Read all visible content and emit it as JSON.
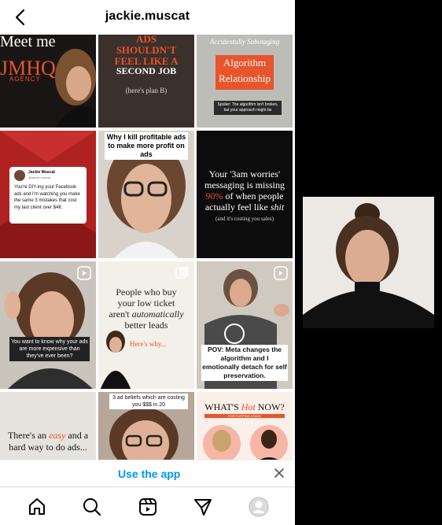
{
  "header": {
    "username": "jackie.muscat"
  },
  "posts": [
    {
      "text": "Meet me",
      "sub": "JMHQ",
      "sub2": "AGENCY"
    },
    {
      "line1": "ADS",
      "line2": "SHOULDN'T",
      "line3": "FEEL LIKE A",
      "line4": "SECOND JOB",
      "line5": "(here's plan B)"
    },
    {
      "top": "Accidentally Sabotaging",
      "hl1": "Algorithm",
      "hl2": "Relationship",
      "foot": "Spoiler: The algorithm isn't broken, but your approach might be"
    },
    {
      "name": "Jackie Muscat",
      "handle": "@jackie.muscat",
      "body": "You're DIY-ing your Facebook ads and I'm watching you make the same 3 mistakes that cost my last client over $4K"
    },
    {
      "caption": "Why I kill profitable ads to make more profit on ads"
    },
    {
      "l1": "Your '3am worries'",
      "l2": "messaging is missing",
      "l3a": "90%",
      "l3b": " of when people",
      "l4": "actually feel like ",
      "l4b": "shit",
      "l5": "(and it's costing you sales)"
    },
    {
      "caption": "You want to know why your ads are more expensive than they've ever been?"
    },
    {
      "l1": "People who buy",
      "l2": "your low ticket",
      "l3": "aren't ",
      "l3b": "automatically",
      "l4": "better leads",
      "l5": "Here's why..."
    },
    {
      "caption": "POV: Meta changes the algorithm and I emotionally detach for self preservation."
    },
    {
      "l1": "There's an ",
      "l1b": "easy",
      "l1c": " and a",
      "l2": "hard way to do ads..."
    },
    {
      "caption": "3 ad beliefs which are costing you $$$ in 20"
    },
    {
      "l1": "WHAT'S ",
      "l1b": "Hot",
      "l1c": " NOW?",
      "l2": "FOR FLIPPING LEADS"
    }
  ],
  "banner": {
    "label": "Use the app"
  },
  "nav": {
    "items": [
      "home-icon",
      "search-icon",
      "reels-icon",
      "direct-icon",
      "profile-icon"
    ]
  }
}
